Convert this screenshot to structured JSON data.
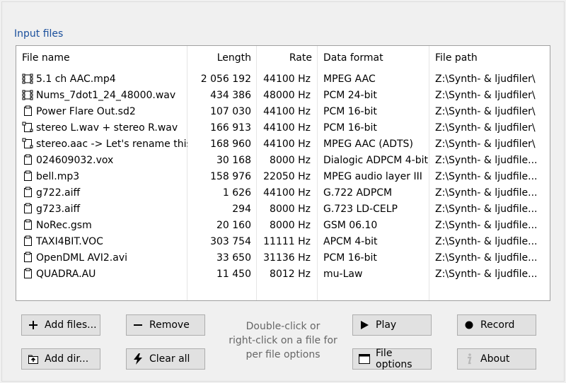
{
  "group_title": "Input files",
  "columns": {
    "name": "File name",
    "length": "Length",
    "rate": "Rate",
    "format": "Data format",
    "path": "File path"
  },
  "rows": [
    {
      "icon": "multichannel-file-icon",
      "name": "5.1 ch AAC.mp4",
      "length": "2 056 192",
      "rate": "44100 Hz",
      "format": "MPEG AAC",
      "path": "Z:\\Synth- & ljudfiler\\"
    },
    {
      "icon": "multichannel-file-icon",
      "name": "Nums_7dot1_24_48000.wav",
      "length": "434 386",
      "rate": "48000 Hz",
      "format": "PCM 24-bit",
      "path": "Z:\\Synth- & ljudfiler\\"
    },
    {
      "icon": "mono-file-icon",
      "name": "Power Flare Out.sd2",
      "length": "107 030",
      "rate": "44100 Hz",
      "format": "PCM 16-bit",
      "path": "Z:\\Synth- & ljudfiler\\"
    },
    {
      "icon": "stereo-file-icon",
      "name": "stereo L.wav + stereo R.wav",
      "length": "166 913",
      "rate": "44100 Hz",
      "format": "PCM 16-bit",
      "path": "Z:\\Synth- & ljudfiler\\"
    },
    {
      "icon": "stereo-file-icon",
      "name": "stereo.aac -> Let's rename this",
      "length": "168 960",
      "rate": "44100 Hz",
      "format": "MPEG AAC (ADTS)",
      "path": "Z:\\Synth- & ljudfiler\\"
    },
    {
      "icon": "mono-file-icon",
      "name": "024609032.vox",
      "length": "30 168",
      "rate": "8000 Hz",
      "format": "Dialogic ADPCM 4-bit",
      "path": "Z:\\Synth- & ljudfile..."
    },
    {
      "icon": "mono-file-icon",
      "name": "bell.mp3",
      "length": "158 976",
      "rate": "22050 Hz",
      "format": "MPEG audio layer III",
      "path": "Z:\\Synth- & ljudfile..."
    },
    {
      "icon": "mono-file-icon",
      "name": "g722.aiff",
      "length": "1 626",
      "rate": "44100 Hz",
      "format": "G.722 ADPCM",
      "path": "Z:\\Synth- & ljudfile..."
    },
    {
      "icon": "mono-file-icon",
      "name": "g723.aiff",
      "length": "294",
      "rate": "8000 Hz",
      "format": "G.723 LD-CELP",
      "path": "Z:\\Synth- & ljudfile..."
    },
    {
      "icon": "mono-file-icon",
      "name": "NoRec.gsm",
      "length": "20 160",
      "rate": "8000 Hz",
      "format": "GSM 06.10",
      "path": "Z:\\Synth- & ljudfile..."
    },
    {
      "icon": "mono-file-icon",
      "name": "TAXI4BIT.VOC",
      "length": "303 754",
      "rate": "11111 Hz",
      "format": "APCM 4-bit",
      "path": "Z:\\Synth- & ljudfile..."
    },
    {
      "icon": "mono-file-icon",
      "name": "OpenDML AVI2.avi",
      "length": "33 650",
      "rate": "31136 Hz",
      "format": "PCM 16-bit",
      "path": "Z:\\Synth- & ljudfile..."
    },
    {
      "icon": "mono-file-icon",
      "name": "QUADRA.AU",
      "length": "11 450",
      "rate": "8012 Hz",
      "format": "mu-Law",
      "path": "Z:\\Synth- & ljudfile..."
    }
  ],
  "buttons": {
    "add_files": "Add files...",
    "remove": "Remove",
    "play": "Play",
    "record": "Record",
    "add_dir": "Add dir...",
    "clear_all": "Clear all",
    "file_options": "File options",
    "about": "About"
  },
  "hint": {
    "line1": "Double-click or",
    "line2": "right-click on a file for",
    "line3": "per file options"
  },
  "colors": {
    "group_title": "#1a4f9c",
    "record_dot": "#000000",
    "about_icon": "#b8b8b8"
  }
}
